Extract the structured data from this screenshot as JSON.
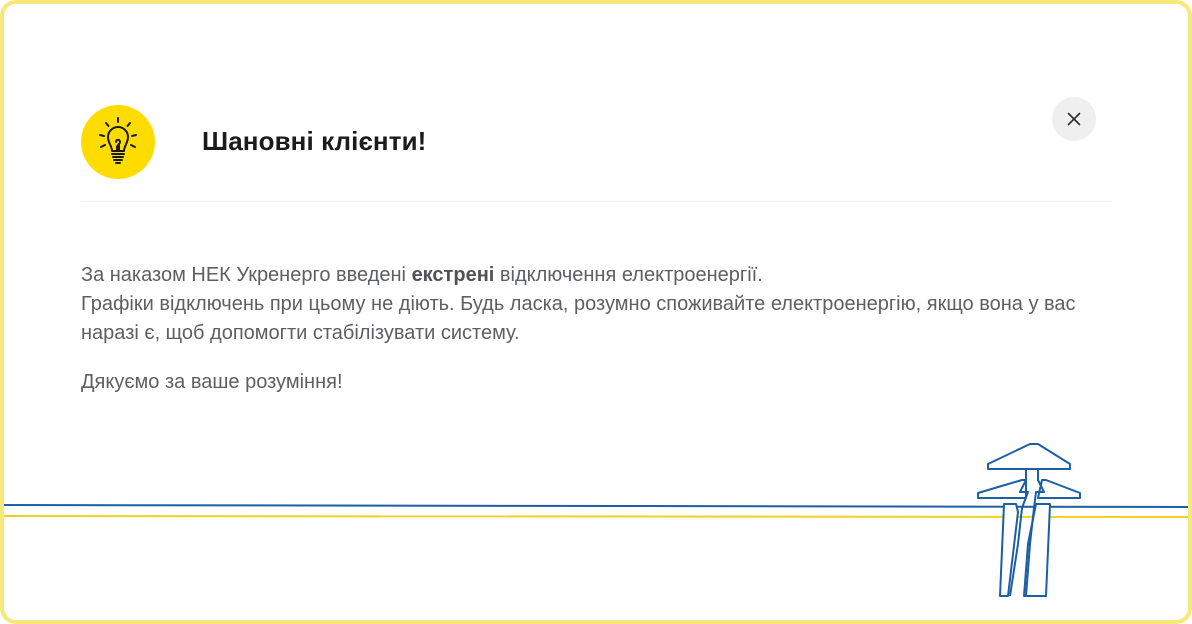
{
  "notice": {
    "title": "Шановні клієнти!",
    "body": {
      "line1_before": "За наказом НЕК Укренерго введені ",
      "line1_emphasis": "екстрені",
      "line1_after": " відключення електроенергії.",
      "line2": "Графіки відключень при цьому не діють.  Будь ласка, розумно споживайте електроенергію, якщо вона у вас наразі є, щоб допомогти стабілізувати систему.",
      "thanks": "Дякуємо за ваше розуміння!"
    },
    "close_icon": "close-icon",
    "badge_icon": "lightbulb-icon",
    "decoration_icon": "power-tower-icon"
  },
  "colors": {
    "accent_yellow": "#ffdc00",
    "frame_yellow": "#f6e97a",
    "line_blue": "#1b5fa5",
    "text_gray": "#5b5f66",
    "title_dark": "#1b1b1b",
    "close_bg": "#efefef"
  }
}
